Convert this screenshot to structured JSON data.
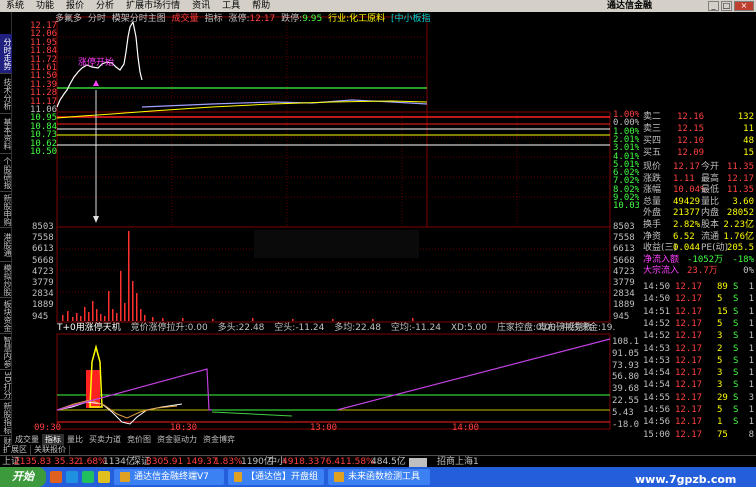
{
  "menu": {
    "items": [
      "系统",
      "功能",
      "报价",
      "分析",
      "扩展市场行情",
      "资讯",
      "工具",
      "帮助"
    ],
    "window_title": "通达信金融"
  },
  "left_tabs": [
    {
      "label": "分时走势",
      "active": true
    },
    {
      "label": "技术分析",
      "active": false
    },
    {
      "label": "基本资料",
      "active": false
    },
    {
      "label": "个股研报",
      "active": false
    },
    {
      "label": "新股申购",
      "active": false
    },
    {
      "label": "港股通",
      "active": false
    },
    {
      "label": "模拟炒股",
      "active": false
    },
    {
      "label": "板块资金",
      "active": false
    },
    {
      "label": "智慧内参",
      "active": false
    },
    {
      "label": "3D打分",
      "active": false
    },
    {
      "label": "新股指标",
      "active": false
    },
    {
      "label": "财经",
      "active": false
    }
  ],
  "header": {
    "stock": "多氟多",
    "mode": "分时",
    "template": "模架分时主图",
    "volume_label": "成交量",
    "indicator_label": "指标",
    "limit_up_label": "涨停:",
    "limit_up_value": "12.17",
    "limit_down_label": "跌停:",
    "limit_down_value": "9.95",
    "industry": "行业:化工原料",
    "index_tag": "[中小板指"
  },
  "annotation": "涨停开始",
  "price_axis": [
    "12.17",
    "12.06",
    "11.95",
    "11.84",
    "11.72",
    "11.61",
    "11.50",
    "11.39",
    "11.28",
    "11.17",
    "11.06",
    "10.95",
    "10.84",
    "10.73",
    "10.62",
    "10.50"
  ],
  "pct_axis": [
    "1.00%",
    "0.00%",
    "1.00%",
    "2.01%",
    "3.01%",
    "4.01%",
    "5.01%",
    "6.02%",
    "7.02%",
    "8.02%",
    "9.02%",
    "10.03%"
  ],
  "vol_axis": [
    "8503",
    "7558",
    "6613",
    "5668",
    "4723",
    "3779",
    "2834",
    "1889",
    "945"
  ],
  "indicator_header": {
    "name": "T+0用涨停天机",
    "items": [
      "竞价涨停拉升:0.00",
      "多头:22.48",
      "空头:-11.24",
      "多均:22.48",
      "空均:-11.24",
      "XD:5.00",
      "庄家控盘:0.00",
      "中线资金:19."
    ],
    "overlay": "毒右磅戒竞救"
  },
  "ind_axis": [
    "108.18",
    "91.05",
    "73.93",
    "56.80",
    "39.68",
    "22.55",
    "5.43",
    "-18.03"
  ],
  "time_axis": [
    "09:30",
    "10:30",
    "13:00",
    "14:00"
  ],
  "bottom_tabs": [
    {
      "label": "成交量",
      "active": false
    },
    {
      "label": "指标",
      "active": true
    },
    {
      "label": "量比",
      "active": false
    },
    {
      "label": "买卖力道",
      "active": false
    },
    {
      "label": "竞价图",
      "active": false
    },
    {
      "label": "资金驱动力",
      "active": false
    },
    {
      "label": "资金博弈",
      "active": false
    }
  ],
  "bottom_tabs2": [
    "扩展区",
    "关联报价"
  ],
  "order_book": [
    {
      "label": "卖二",
      "price": "12.16",
      "vol": "132"
    },
    {
      "label": "卖三",
      "price": "12.15",
      "vol": "11"
    },
    {
      "label": "买四",
      "price": "12.10",
      "vol": "48"
    },
    {
      "label": "买五",
      "price": "12.09",
      "vol": "15"
    }
  ],
  "quote": [
    {
      "l1": "现价",
      "v1": "12.17",
      "l2": "今开",
      "v2": "11.35"
    },
    {
      "l1": "涨跌",
      "v1": "1.11",
      "l2": "最高",
      "v2": "12.17"
    },
    {
      "l1": "涨幅",
      "v1": "10.04%",
      "l2": "最低",
      "v2": "11.35"
    },
    {
      "l1": "总量",
      "v1": "49429",
      "l2": "量比",
      "v2": "3.60"
    },
    {
      "l1": "外盘",
      "v1": "21377",
      "l2": "内盘",
      "v2": "28052"
    },
    {
      "l1": "换手",
      "v1": "2.82%",
      "l2": "股本",
      "v2": "2.23亿"
    },
    {
      "l1": "净资",
      "v1": "6.52",
      "l2": "流通",
      "v2": "1.76亿"
    },
    {
      "l1": "收益(三)",
      "v1": "0.044",
      "l2": "PE(动)",
      "v2": "205.5"
    }
  ],
  "flow": [
    {
      "label": "净流入额",
      "v1": "-1052万",
      "v2": "-18%"
    },
    {
      "label": "大宗流入",
      "v1": "23.7万",
      "v2": "0%"
    }
  ],
  "ticks": [
    {
      "t": "14:50",
      "p": "12.17",
      "v": "89",
      "d": "S",
      "n": "1"
    },
    {
      "t": "14:50",
      "p": "12.17",
      "v": "5",
      "d": "S",
      "n": "1"
    },
    {
      "t": "14:51",
      "p": "12.17",
      "v": "15",
      "d": "S",
      "n": "1"
    },
    {
      "t": "14:52",
      "p": "12.17",
      "v": "5",
      "d": "S",
      "n": "1"
    },
    {
      "t": "14:52",
      "p": "12.17",
      "v": "3",
      "d": "S",
      "n": "1"
    },
    {
      "t": "14:53",
      "p": "12.17",
      "v": "2",
      "d": "S",
      "n": "1"
    },
    {
      "t": "14:53",
      "p": "12.17",
      "v": "5",
      "d": "S",
      "n": "1"
    },
    {
      "t": "14:54",
      "p": "12.17",
      "v": "3",
      "d": "S",
      "n": "1"
    },
    {
      "t": "14:54",
      "p": "12.17",
      "v": "3",
      "d": "S",
      "n": "1"
    },
    {
      "t": "14:55",
      "p": "12.17",
      "v": "29",
      "d": "S",
      "n": "3"
    },
    {
      "t": "14:56",
      "p": "12.17",
      "v": "5",
      "d": "S",
      "n": "1"
    },
    {
      "t": "14:56",
      "p": "12.17",
      "v": "1",
      "d": "S",
      "n": "1"
    },
    {
      "t": "15:00",
      "p": "12.17",
      "v": "75",
      "d": "",
      "n": "8"
    }
  ],
  "status": {
    "sh_label": "上证",
    "sh_value": "2135.83",
    "sh_change": "35.32",
    "sh_pct": "1.68%",
    "sh_amount": "1134亿",
    "sz_label": "深证",
    "sz_value": "8305.91",
    "sz_change": "149.37",
    "sz_pct": "1.83%",
    "sz_amount": "1190亿",
    "zx_label": "中小",
    "zx_value": "4918.33",
    "zx_change": "76.41",
    "zx_pct": "1.58%",
    "zx_amount": "484.5亿",
    "link": "招商上海1"
  },
  "taskbar": {
    "start": "开始",
    "tasks": [
      "通达信金融终端V7",
      "【通达信】开盘组",
      "未来函数检测工具"
    ]
  },
  "watermark": "www.7gpzb.com",
  "colors": {
    "up": "#ff3030",
    "down": "#00d000",
    "limit_line": "#ff0000",
    "price_line": "#ffffff",
    "avg_line": "#ffff00",
    "green_line": "#40ff40",
    "purple_line": "#c040e0",
    "magenta_text": "#ff40ff"
  }
}
